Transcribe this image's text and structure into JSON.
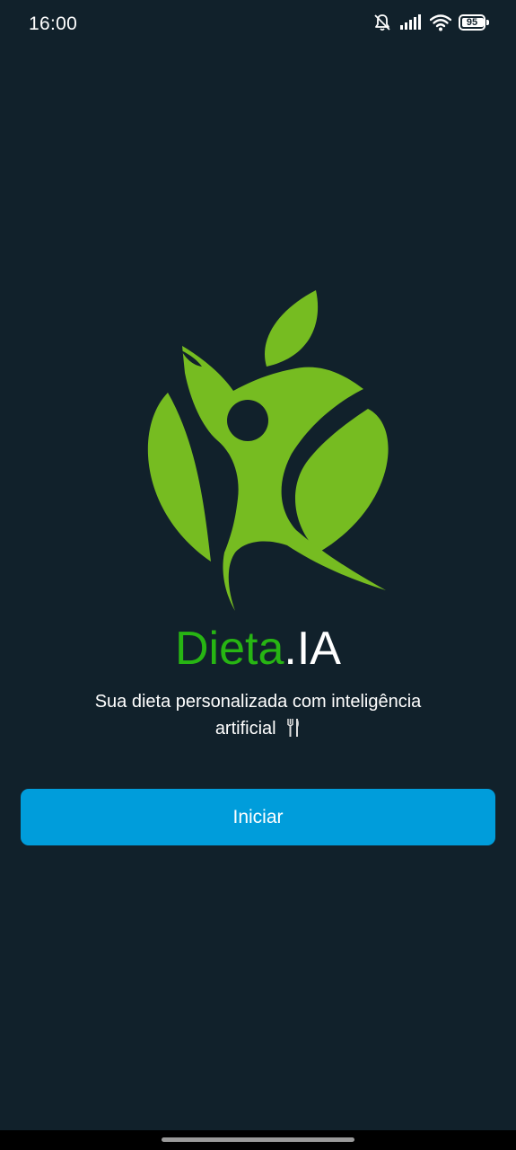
{
  "status_bar": {
    "time": "16:00",
    "battery_level": "95",
    "icons": [
      "bell-muted-icon",
      "signal-icon",
      "wifi-icon",
      "battery-icon"
    ]
  },
  "brand": {
    "name_primary": "Dieta",
    "name_secondary": ".IA",
    "primary_color": "#27b513",
    "logo_color": "#76bc21"
  },
  "tagline": {
    "line1": "Sua dieta personalizada com inteligência",
    "line2": "artificial",
    "icon": "fork-knife-icon"
  },
  "actions": {
    "start_label": "Iniciar",
    "start_color": "#009ddb"
  },
  "theme": {
    "background": "#11212b"
  }
}
